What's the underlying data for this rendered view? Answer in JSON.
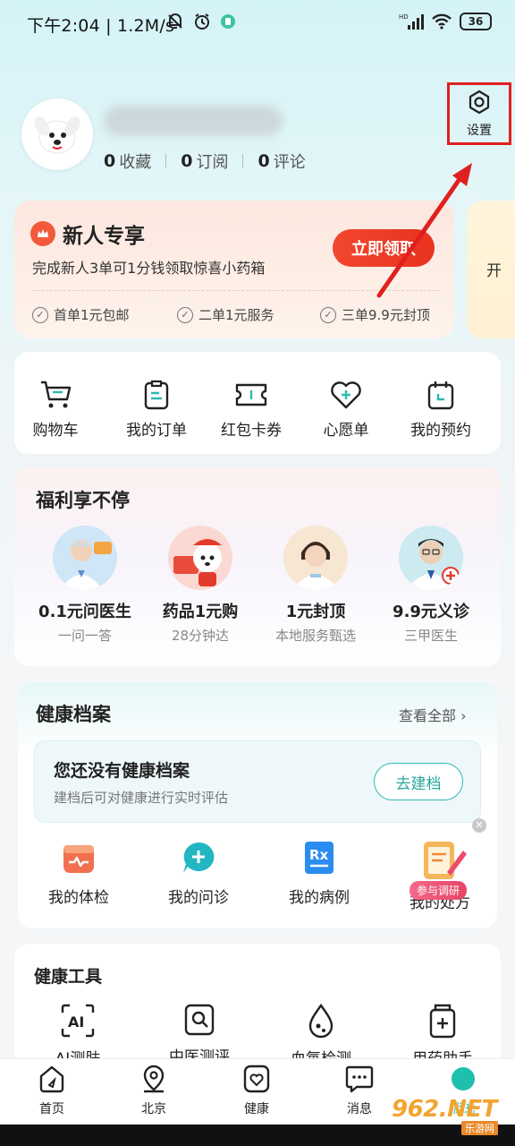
{
  "status_bar": {
    "time_speed": "下午2:04 | 1.2M/s",
    "battery": "36",
    "icons": [
      "mute-icon",
      "alarm-icon",
      "app-notification-icon",
      "hd-signal-icon",
      "wifi-icon",
      "battery-icon"
    ]
  },
  "profile": {
    "stats": [
      {
        "num": "0",
        "label": "收藏"
      },
      {
        "num": "0",
        "label": "订阅"
      },
      {
        "num": "0",
        "label": "评论"
      }
    ],
    "settings_label": "设置"
  },
  "new_user": {
    "title": "新人专享",
    "subtitle": "完成新人3单可1分钱领取惊喜小药箱",
    "button": "立即领取",
    "perks": [
      "首单1元包邮",
      "二单1元服务",
      "三单9.9元封顶"
    ],
    "peek_text": "开"
  },
  "quick_actions": [
    {
      "label": "购物车",
      "icon": "cart-icon"
    },
    {
      "label": "我的订单",
      "icon": "order-icon"
    },
    {
      "label": "红包卡券",
      "icon": "coupon-icon"
    },
    {
      "label": "心愿单",
      "icon": "wishlist-icon"
    },
    {
      "label": "我的预约",
      "icon": "calendar-icon"
    }
  ],
  "welfare": {
    "title": "福利享不停",
    "items": [
      {
        "title": "0.1元问医生",
        "sub": "一问一答"
      },
      {
        "title": "药品1元购",
        "sub": "28分钟达"
      },
      {
        "title": "1元封顶",
        "sub": "本地服务甄选"
      },
      {
        "title": "9.9元义诊",
        "sub": "三甲医生"
      }
    ]
  },
  "health_record": {
    "title": "健康档案",
    "view_all": "查看全部",
    "empty_title": "您还没有健康档案",
    "empty_sub": "建档后可对健康进行实时评估",
    "build_button": "去建档",
    "items": [
      {
        "label": "我的体检"
      },
      {
        "label": "我的问诊"
      },
      {
        "label": "我的病例"
      },
      {
        "label": "我的处方"
      }
    ],
    "survey_tag": "参与调研"
  },
  "health_tools": {
    "title": "健康工具",
    "items": [
      {
        "label": "AI测肤"
      },
      {
        "label": "中医测评"
      },
      {
        "label": "血氧检测"
      },
      {
        "label": "用药助手"
      }
    ]
  },
  "bottom_nav": [
    {
      "label": "首页"
    },
    {
      "label": "北京"
    },
    {
      "label": "健康"
    },
    {
      "label": "消息"
    },
    {
      "label": "我的"
    }
  ],
  "watermark": {
    "main": "962.NET",
    "sub": "乐游网"
  },
  "colors": {
    "accent_red": "#e8321e",
    "accent_teal": "#2fb8b0",
    "annotation_red": "#e02020"
  }
}
